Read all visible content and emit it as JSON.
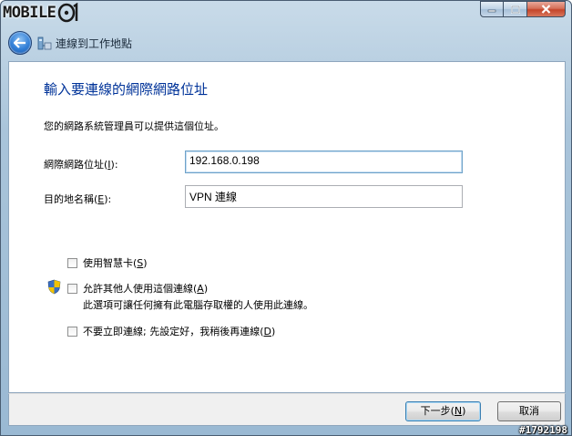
{
  "window": {
    "logo_text": "MOBILE",
    "caption": {
      "minimize": "minimize-icon",
      "maximize": "maximize-icon",
      "close": "close-icon"
    }
  },
  "nav": {
    "title": "連線到工作地點"
  },
  "main": {
    "heading": "輸入要連線的網際網路位址",
    "intro": "您的網路系統管理員可以提供這個位址。",
    "address_label": "網際網路位址",
    "address_key": "I",
    "address_value": "192.168.0.198",
    "dest_label": "目的地名稱",
    "dest_key": "E",
    "dest_value": "VPN 連線",
    "smartcard_label": "使用智慧卡",
    "smartcard_key": "S",
    "allow_others_label": "允許其他人使用這個連線",
    "allow_others_key": "A",
    "allow_others_note": "此選項可讓任何擁有此電腦存取權的人使用此連線。",
    "dont_connect_label": "不要立即連線; 先設定好，我稍後再連線",
    "dont_connect_key": "D"
  },
  "footer": {
    "next_label": "下一步",
    "next_key": "N",
    "cancel_label": "取消"
  },
  "watermark": "#1792198"
}
